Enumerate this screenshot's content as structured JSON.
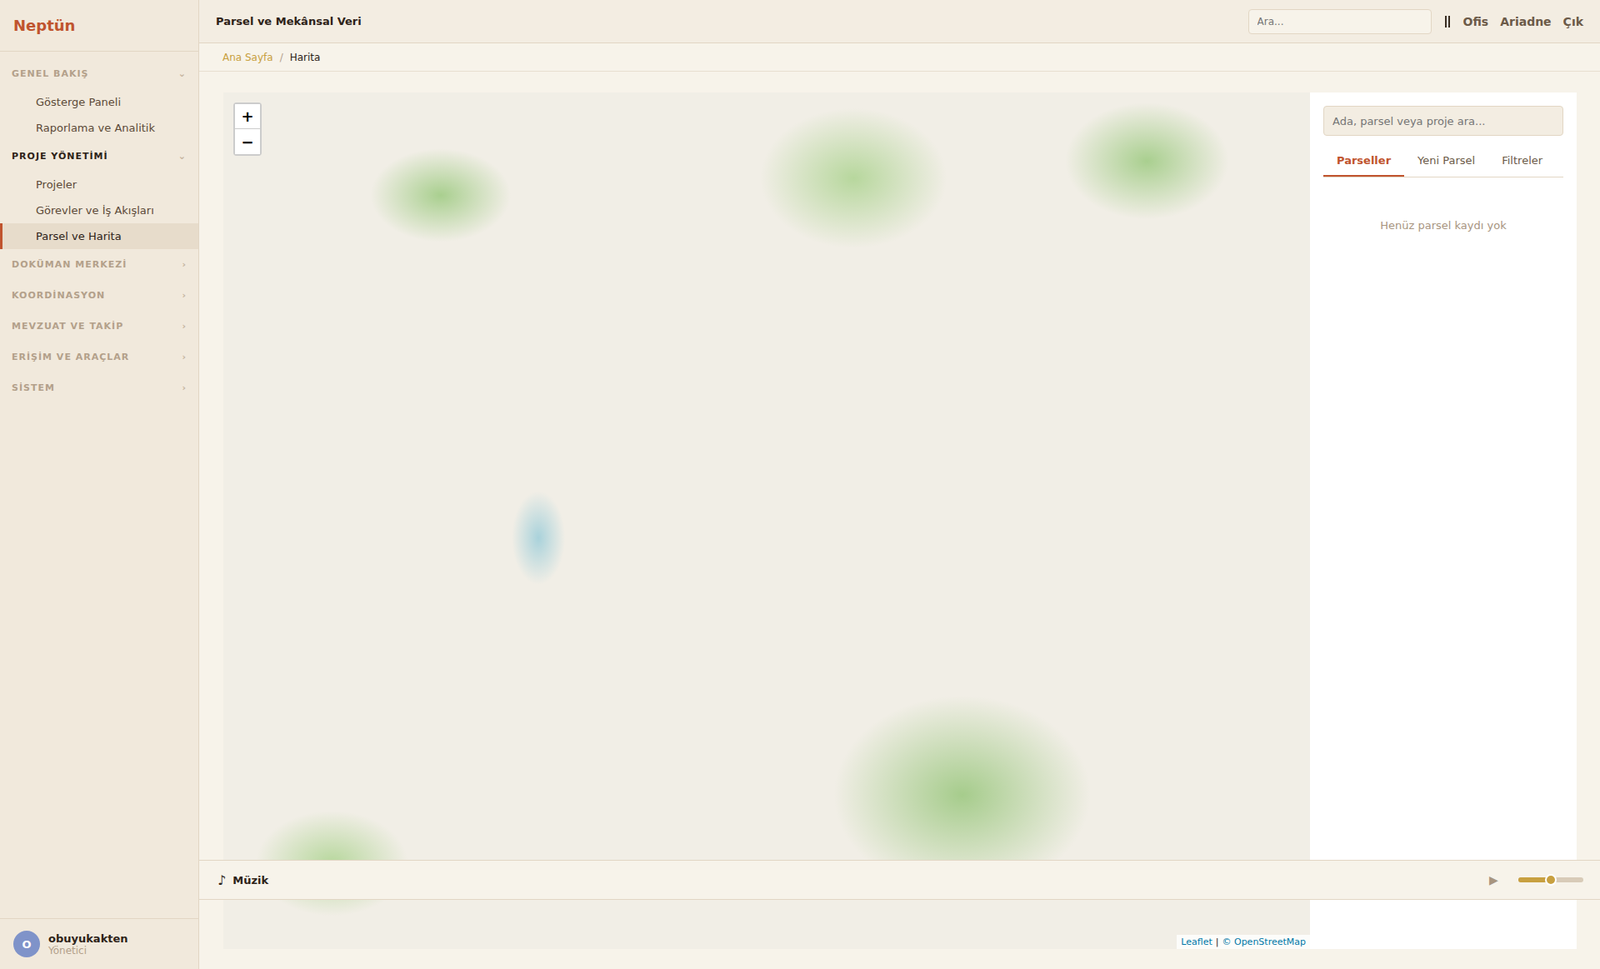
{
  "app": {
    "logo": "Neptün"
  },
  "header": {
    "title": "Parsel ve Mekânsal Veri",
    "search_placeholder": "Ara...",
    "actions": [
      "Ofis",
      "Ariadne",
      "Çık"
    ]
  },
  "breadcrumb": [
    {
      "label": "Ana Sayfa",
      "selected": false
    },
    {
      "label": "Harita",
      "selected": true
    }
  ],
  "sidebar": {
    "sections": [
      {
        "label": "GENEL BAKIŞ",
        "expanded": true,
        "chevron": "⌄",
        "items": [
          {
            "label": "Gösterge Paneli",
            "selected": false
          },
          {
            "label": "Raporlama ve Analitik",
            "selected": false
          }
        ]
      },
      {
        "label": "PROJE YÖNETİMİ",
        "expanded": true,
        "chevron": "⌄",
        "items": [
          {
            "label": "Projeler",
            "selected": false
          },
          {
            "label": "Görevler ve İş Akışları",
            "selected": false
          },
          {
            "label": "Parsel ve Harita",
            "selected": true
          }
        ]
      },
      {
        "label": "DOKÜMAN MERKEZİ",
        "expanded": false,
        "chevron": "›",
        "items": []
      },
      {
        "label": "KOORDİNASYON",
        "expanded": false,
        "chevron": "›",
        "items": []
      },
      {
        "label": "MEVZUAT VE TAKİP",
        "expanded": false,
        "chevron": "›",
        "items": []
      },
      {
        "label": "ERİŞİM VE ARAÇLAR",
        "expanded": false,
        "chevron": "›",
        "items": []
      },
      {
        "label": "SİSTEM",
        "expanded": false,
        "chevron": "›",
        "items": []
      }
    ]
  },
  "user": {
    "avatar": "O",
    "name": "obuyukakten",
    "role": "Yönetici"
  },
  "map": {
    "zoom_in": "+",
    "zoom_out": "−",
    "attribution": [
      "Leaflet",
      "© OpenStreetMap"
    ],
    "separator": "|"
  },
  "panel": {
    "search_placeholder": "Ada, parsel veya proje ara...",
    "tabs": [
      {
        "label": "Parseller",
        "selected": true
      },
      {
        "label": "Yeni Parsel",
        "selected": false
      },
      {
        "label": "Filtreler",
        "selected": false
      }
    ],
    "empty": "Henüz parsel kaydı yok"
  },
  "player": {
    "icon": "♪",
    "title": "Müzik",
    "play": "▶",
    "level": 0.5
  }
}
